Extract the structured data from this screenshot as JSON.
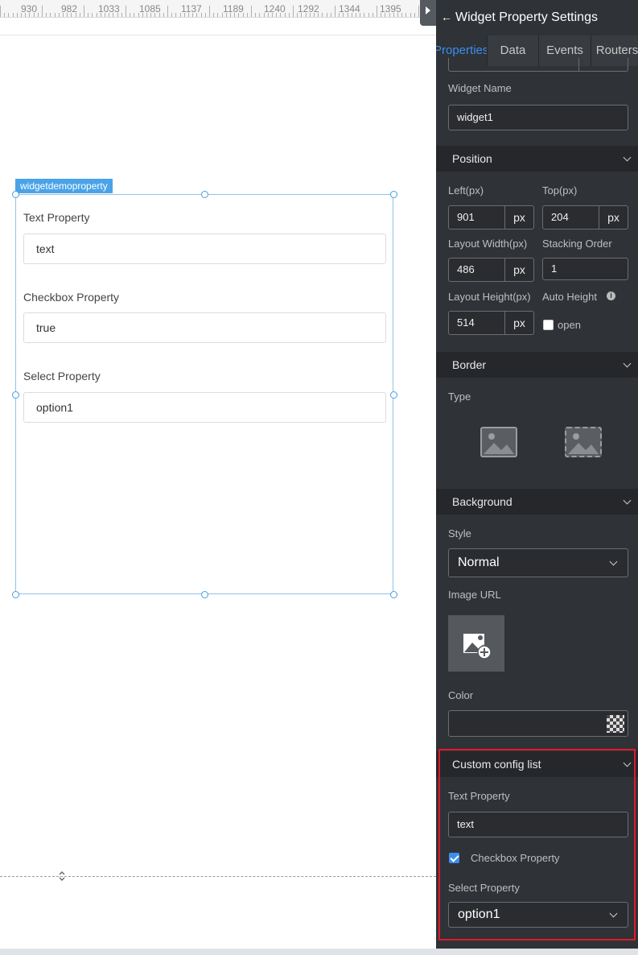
{
  "ruler": {
    "labels": [
      "930",
      "982",
      "1033",
      "1085",
      "1137",
      "1189",
      "1240",
      "1292",
      "1344",
      "1395"
    ]
  },
  "widget": {
    "tag": "widgetdemoproperty",
    "fields": [
      {
        "label": "Text Property",
        "value": "text"
      },
      {
        "label": "Checkbox Property",
        "value": "true"
      },
      {
        "label": "Select Property",
        "value": "option1"
      }
    ]
  },
  "panel": {
    "title": "Widget Property Settings",
    "tabs": [
      "Properties",
      "Data",
      "Events",
      "Routers"
    ],
    "widget_name_label": "Widget Name",
    "widget_name_value": "widget1",
    "position": {
      "title": "Position",
      "left_label": "Left(px)",
      "left_value": "901",
      "top_label": "Top(px)",
      "top_value": "204",
      "width_label": "Layout Width(px)",
      "width_value": "486",
      "order_label": "Stacking Order",
      "order_value": "1",
      "height_label": "Layout Height(px)",
      "height_value": "514",
      "auto_label": "Auto Height",
      "auto_open_label": "open",
      "unit": "px"
    },
    "border": {
      "title": "Border",
      "type_label": "Type"
    },
    "background": {
      "title": "Background",
      "style_label": "Style",
      "style_value": "Normal",
      "image_url_label": "Image URL",
      "color_label": "Color"
    },
    "custom": {
      "title": "Custom config list",
      "text_label": "Text Property",
      "text_value": "text",
      "checkbox_label": "Checkbox Property",
      "checkbox_checked": true,
      "select_label": "Select Property",
      "select_value": "option1"
    }
  },
  "colors": {
    "accent": "#3c8ef0",
    "panel_bg": "#2f3237",
    "highlight": "#e0192a"
  }
}
